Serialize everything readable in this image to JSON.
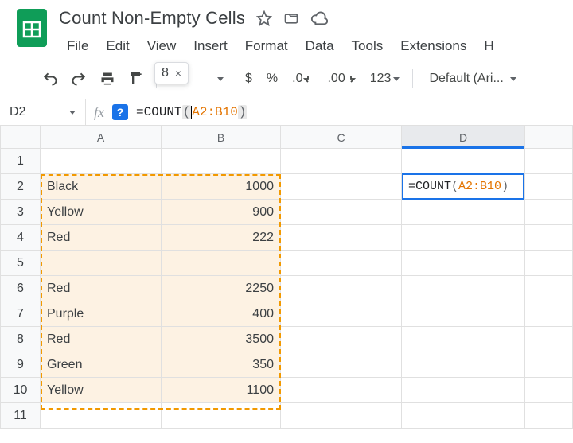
{
  "header": {
    "title": "Count Non-Empty Cells"
  },
  "menu": {
    "file": "File",
    "edit": "Edit",
    "view": "View",
    "insert": "Insert",
    "format": "Format",
    "data": "Data",
    "tools": "Tools",
    "extensions": "Extensions",
    "help": "H"
  },
  "toolbar": {
    "currency": "$",
    "percent": "%",
    "dec_less": ".0",
    "dec_more": ".00",
    "numfmt": "123",
    "font": "Default (Ari...",
    "preview_value": "8",
    "preview_close": "×",
    "help_badge": "?"
  },
  "formula_bar": {
    "name_box": "D2",
    "fx": "fx",
    "eq": "=",
    "fn": "COUNT",
    "open": "(",
    "range": "A2:B10",
    "close": ")"
  },
  "columns": [
    "A",
    "B",
    "C",
    "D"
  ],
  "rows": [
    "1",
    "2",
    "3",
    "4",
    "5",
    "6",
    "7",
    "8",
    "9",
    "10",
    "11"
  ],
  "cells": {
    "A2": "Black",
    "B2": "1000",
    "A3": "Yellow",
    "B3": "900",
    "A4": "Red",
    "B4": "222",
    "A6": "Red",
    "B6": "2250",
    "A7": "Purple",
    "B7": "400",
    "A8": "Red",
    "B8": "3500",
    "A9": "Green",
    "B9": "350",
    "A10": "Yellow",
    "B10": "1100"
  },
  "active_cell": {
    "eq": "=",
    "fn": "COUNT",
    "open": "(",
    "range": "A2:B10",
    "close": ")"
  },
  "chart_data": {
    "type": "table",
    "columns": [
      "A",
      "B"
    ],
    "rows": [
      {
        "A": "Black",
        "B": 1000
      },
      {
        "A": "Yellow",
        "B": 900
      },
      {
        "A": "Red",
        "B": 222
      },
      {
        "A": "",
        "B": null
      },
      {
        "A": "Red",
        "B": 2250
      },
      {
        "A": "Purple",
        "B": 400
      },
      {
        "A": "Red",
        "B": 3500
      },
      {
        "A": "Green",
        "B": 350
      },
      {
        "A": "Yellow",
        "B": 1100
      }
    ],
    "formula": "=COUNT(A2:B10)",
    "result_preview": 8
  }
}
